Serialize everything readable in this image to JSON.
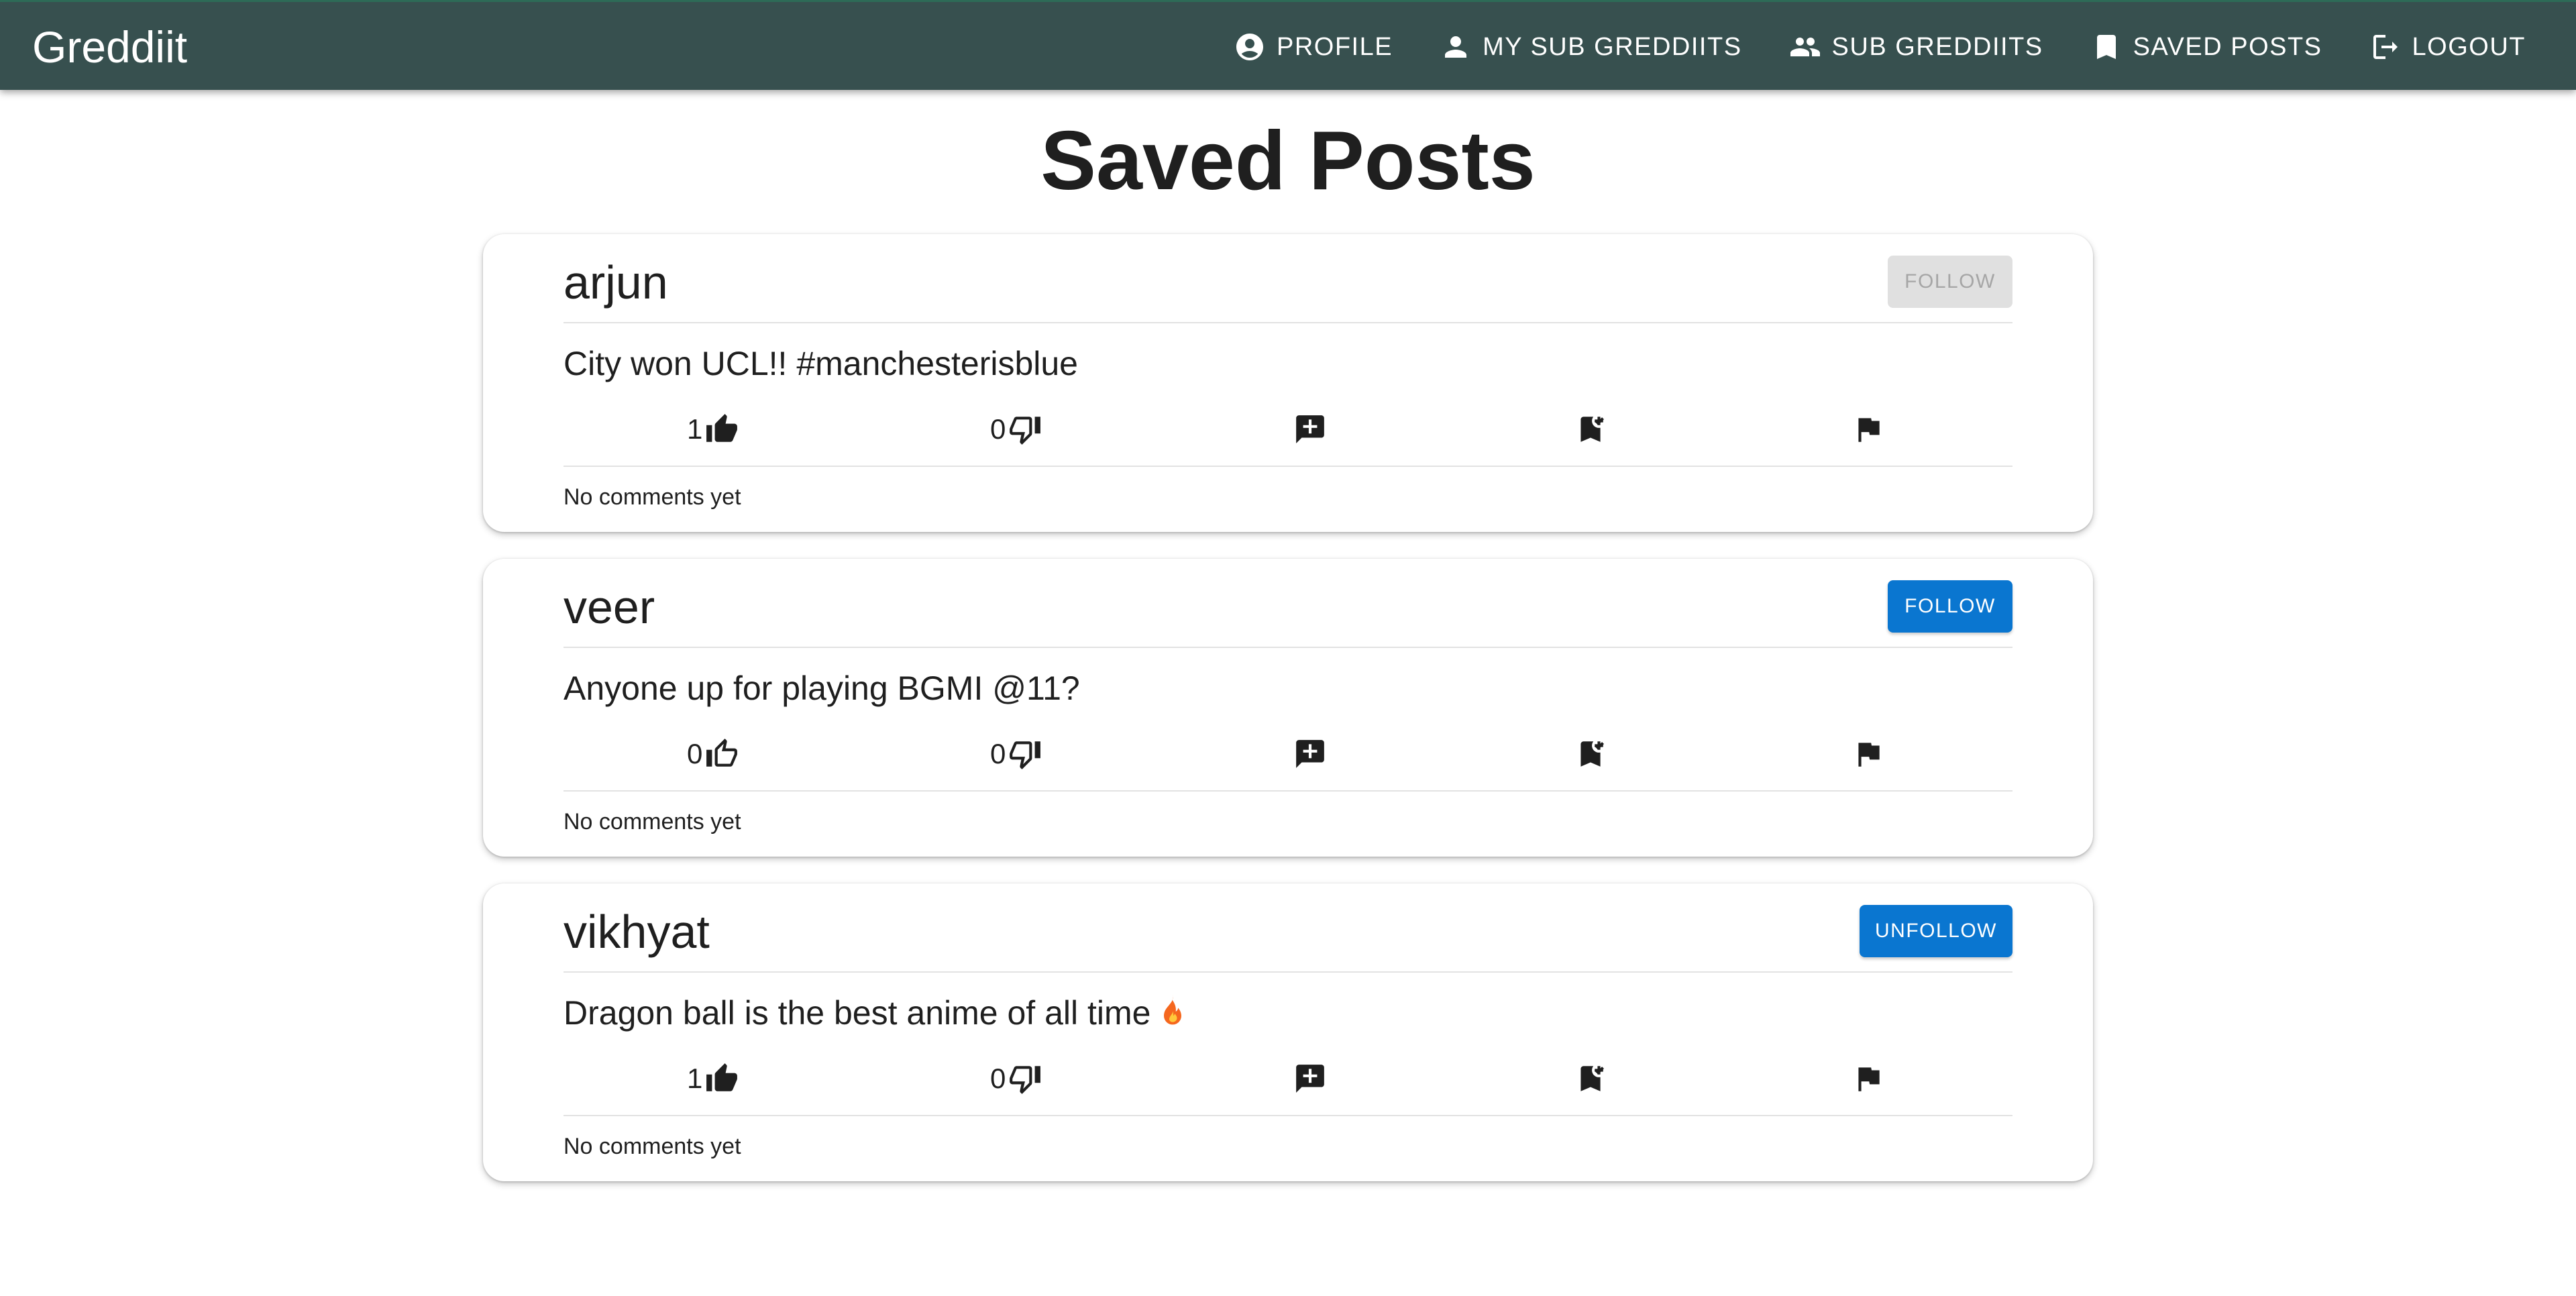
{
  "app": {
    "title": "Greddiit"
  },
  "nav": {
    "profile": "PROFILE",
    "my_sub_greddiits": "MY SUB GREDDIITS",
    "sub_greddiits": "SUB GREDDIITS",
    "saved_posts": "SAVED POSTS",
    "logout": "LOGOUT"
  },
  "page": {
    "title": "Saved Posts"
  },
  "posts": [
    {
      "author": "arjun",
      "follow_label": "FOLLOW",
      "follow_state": "disabled",
      "text": "City won UCL!! #manchesterisblue",
      "upvotes": "1",
      "upvoted": true,
      "downvotes": "0",
      "comments": "No comments yet"
    },
    {
      "author": "veer",
      "follow_label": "FOLLOW",
      "follow_state": "enabled",
      "text": "Anyone up for playing BGMI @11?",
      "upvotes": "0",
      "upvoted": false,
      "downvotes": "0",
      "comments": "No comments yet"
    },
    {
      "author": "vikhyat",
      "follow_label": "UNFOLLOW",
      "follow_state": "enabled",
      "text": "Dragon ball is the best anime of all time",
      "text_emoji": "fire-emoji",
      "upvotes": "1",
      "upvoted": true,
      "downvotes": "0",
      "comments": "No comments yet"
    }
  ],
  "icons": {
    "profile": "account-circle-icon",
    "my_sub_greddiits": "person-icon",
    "sub_greddiits": "people-icon",
    "saved_posts": "bookmark-icon",
    "logout": "logout-icon",
    "upvote": "thumb-up-icon",
    "downvote": "thumb-down-icon",
    "comment": "add-comment-icon",
    "saved": "bookmark-added-icon",
    "report": "flag-icon"
  },
  "colors": {
    "appbar": "#37504f",
    "primary_button": "#0a76d0",
    "disabled_button": "#e0e0e0"
  }
}
